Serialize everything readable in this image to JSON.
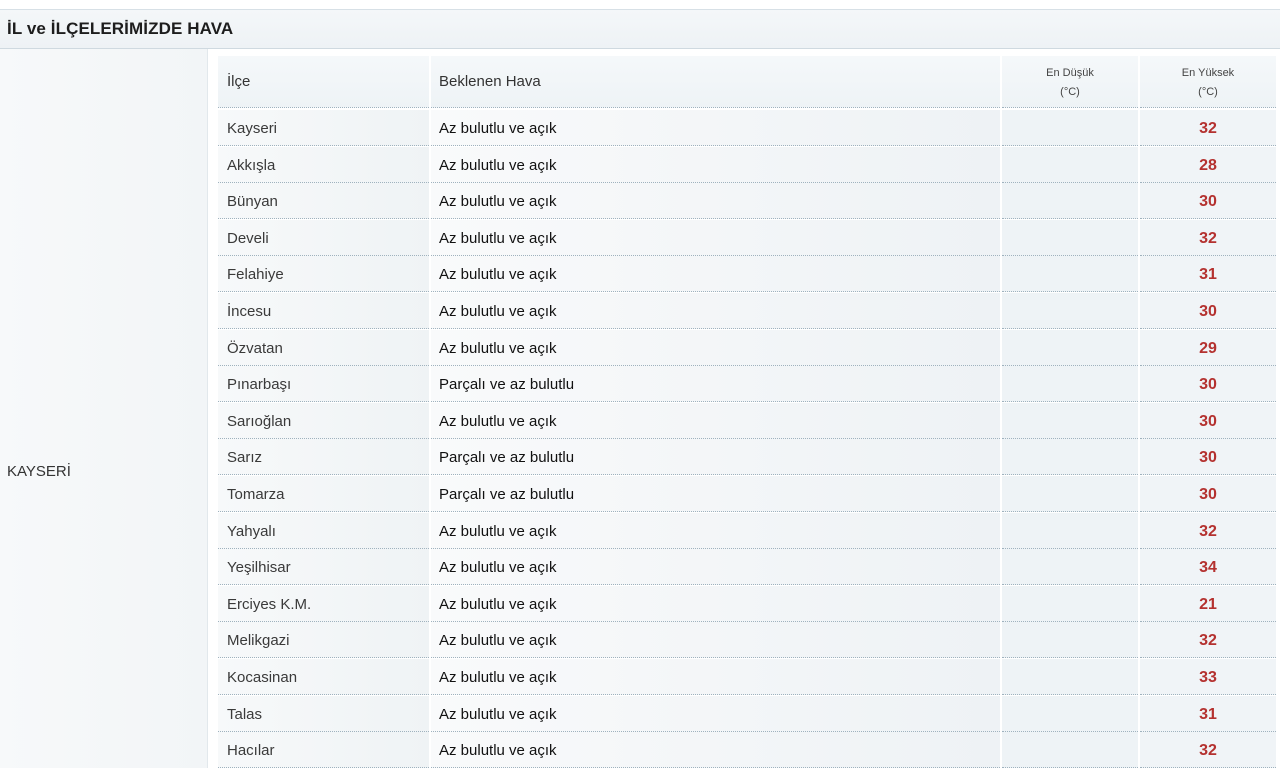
{
  "panel": {
    "title": "İL ve İLÇELERİMİZDE HAVA",
    "region": "KAYSERİ"
  },
  "table": {
    "headers": {
      "district": "İlçe",
      "forecast": "Beklenen Hava",
      "low_line1": "En Düşük",
      "low_line2": "(°C)",
      "high_line1": "En Yüksek",
      "high_line2": "(°C)"
    },
    "rows": [
      {
        "district": "Kayseri",
        "forecast": "Az bulutlu ve açık",
        "low": "",
        "high": "32"
      },
      {
        "district": "Akkışla",
        "forecast": "Az bulutlu ve açık",
        "low": "",
        "high": "28"
      },
      {
        "district": "Bünyan",
        "forecast": "Az bulutlu ve açık",
        "low": "",
        "high": "30"
      },
      {
        "district": "Develi",
        "forecast": "Az bulutlu ve açık",
        "low": "",
        "high": "32"
      },
      {
        "district": "Felahiye",
        "forecast": "Az bulutlu ve açık",
        "low": "",
        "high": "31"
      },
      {
        "district": "İncesu",
        "forecast": "Az bulutlu ve açık",
        "low": "",
        "high": "30"
      },
      {
        "district": "Özvatan",
        "forecast": "Az bulutlu ve açık",
        "low": "",
        "high": "29"
      },
      {
        "district": "Pınarbaşı",
        "forecast": "Parçalı ve az bulutlu",
        "low": "",
        "high": "30"
      },
      {
        "district": "Sarıoğlan",
        "forecast": "Az bulutlu ve açık",
        "low": "",
        "high": "30"
      },
      {
        "district": "Sarız",
        "forecast": "Parçalı ve az bulutlu",
        "low": "",
        "high": "30"
      },
      {
        "district": "Tomarza",
        "forecast": "Parçalı ve az bulutlu",
        "low": "",
        "high": "30"
      },
      {
        "district": "Yahyalı",
        "forecast": "Az bulutlu ve açık",
        "low": "",
        "high": "32"
      },
      {
        "district": "Yeşilhisar",
        "forecast": "Az bulutlu ve açık",
        "low": "",
        "high": "34"
      },
      {
        "district": "Erciyes K.M.",
        "forecast": "Az bulutlu ve açık",
        "low": "",
        "high": "21"
      },
      {
        "district": "Melikgazi",
        "forecast": "Az bulutlu ve açık",
        "low": "",
        "high": "32"
      },
      {
        "district": "Kocasinan",
        "forecast": "Az bulutlu ve açık",
        "low": "",
        "high": "33"
      },
      {
        "district": "Talas",
        "forecast": "Az bulutlu ve açık",
        "low": "",
        "high": "31"
      },
      {
        "district": "Hacılar",
        "forecast": "Az bulutlu ve açık",
        "low": "",
        "high": "32"
      }
    ]
  },
  "colors": {
    "high_temp": "#b4312f",
    "header_bg": "#eef2f5"
  }
}
